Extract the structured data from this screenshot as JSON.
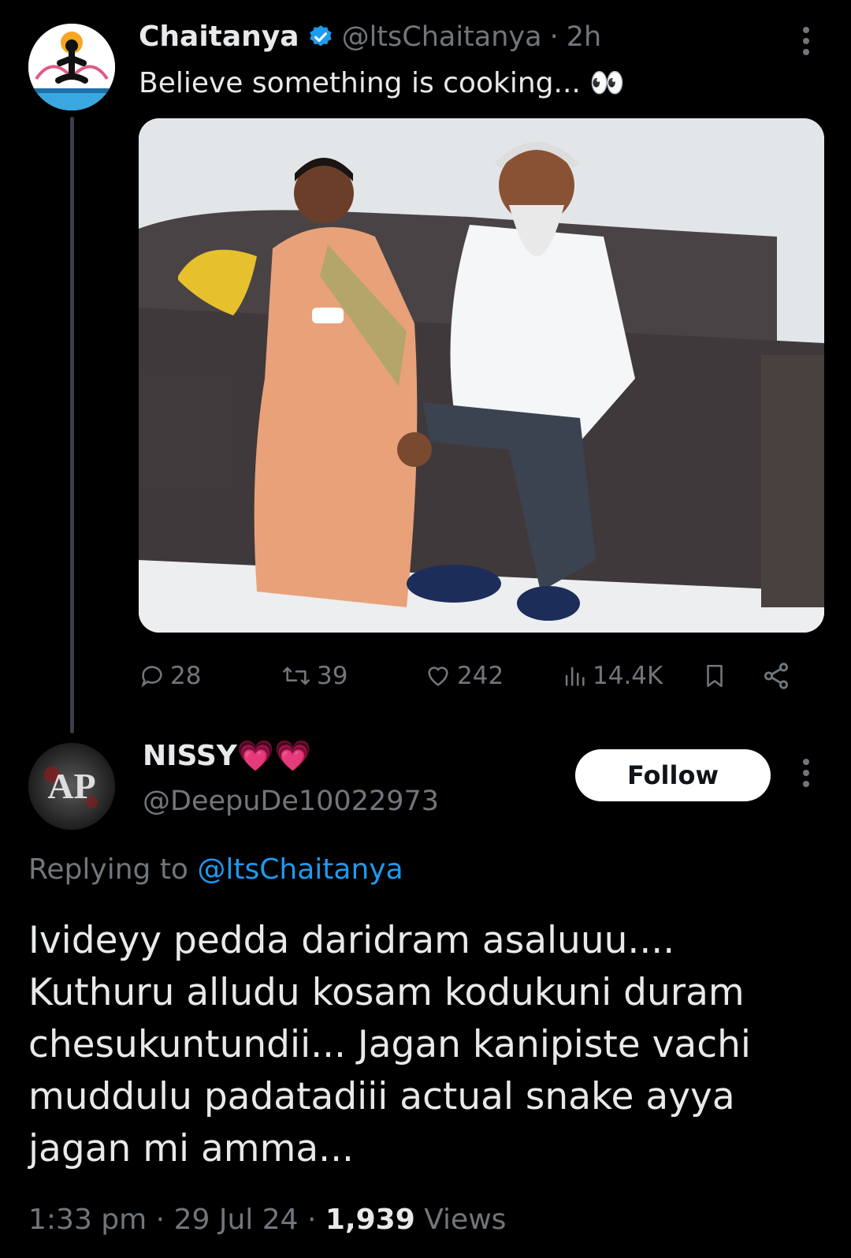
{
  "parent": {
    "author_name": "Chaitanya",
    "handle": "@ltsChaitanya",
    "separator": "·",
    "time": "2h",
    "text": "Believe something is cooking... 👀",
    "stats": {
      "replies": "28",
      "retweets": "39",
      "likes": "242",
      "views": "14.4K"
    }
  },
  "reply": {
    "author_name": "NISSY",
    "name_emoji": "💗💗",
    "handle": "@DeepuDe10022973",
    "follow_label": "Follow",
    "replying_prefix": "Replying to",
    "replying_handle": "@ltsChaitanya",
    "text_lines": [
      "Ivideyy pedda daridram asaluuu....",
      "Kuthuru alludu kosam kodukuni duram",
      "chesukuntundii... Jagan kanipiste vachi",
      "muddulu padatadiii actual snake ayya",
      "jagan mi amma..."
    ],
    "time": "1:33 pm",
    "date": "29 Jul 24",
    "dot": "·",
    "views_count": "1,939",
    "views_label": "Views",
    "avatar_text": "AP"
  },
  "colors": {
    "accent": "#1d9bf0",
    "verified": "#1d9bf0",
    "muted": "#71767b",
    "text": "#e7e9ea"
  }
}
